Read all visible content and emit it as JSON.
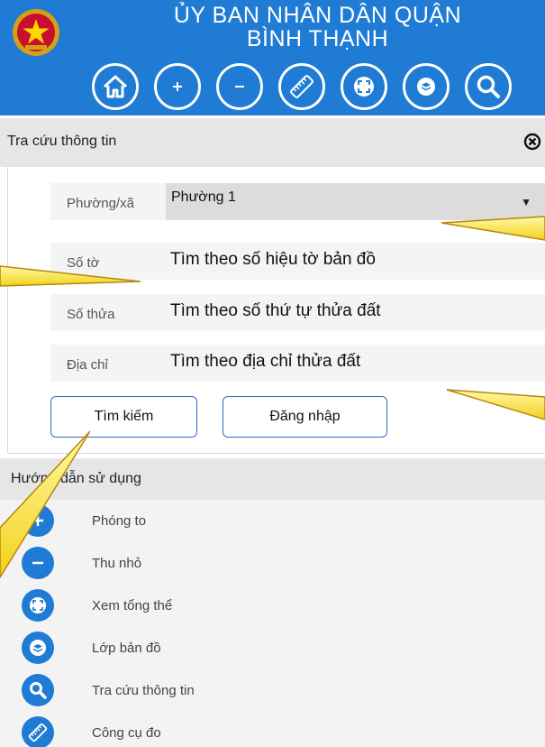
{
  "header": {
    "title_line1": "ỦY BAN NHÂN DÂN QUẬN",
    "title_line2": "BÌNH THẠNH",
    "tools": [
      "home-icon",
      "zoom-in-icon",
      "zoom-out-icon",
      "ruler-icon",
      "fullscreen-icon",
      "layers-icon",
      "search-icon"
    ],
    "accent": "#1f7bd4"
  },
  "search_panel": {
    "title": "Tra cứu thông tin",
    "ward_label": "Phường/xã",
    "ward_value": "Phường 1",
    "sheet_label": "Số tờ",
    "sheet_placeholder": "Tìm theo số hiệu tờ bản đồ",
    "parcel_label": "Số thửa",
    "parcel_placeholder": "Tìm theo số thứ tự thửa đất",
    "address_label": "Địa chỉ",
    "address_placeholder": "Tìm theo địa chỉ thửa đất",
    "search_button": "Tìm kiếm",
    "login_button": "Đăng nhập"
  },
  "guide": {
    "title": "Hướng dẫn sử dụng",
    "items": [
      {
        "icon": "zoom-in-icon",
        "label": "Phóng to"
      },
      {
        "icon": "zoom-out-icon",
        "label": "Thu nhỏ"
      },
      {
        "icon": "fullscreen-icon",
        "label": "Xem tổng thể"
      },
      {
        "icon": "layers-icon",
        "label": "Lớp bản đồ"
      },
      {
        "icon": "search-icon",
        "label": "Tra cứu thông tin"
      },
      {
        "icon": "ruler-icon",
        "label": "Công cụ đo"
      }
    ]
  }
}
